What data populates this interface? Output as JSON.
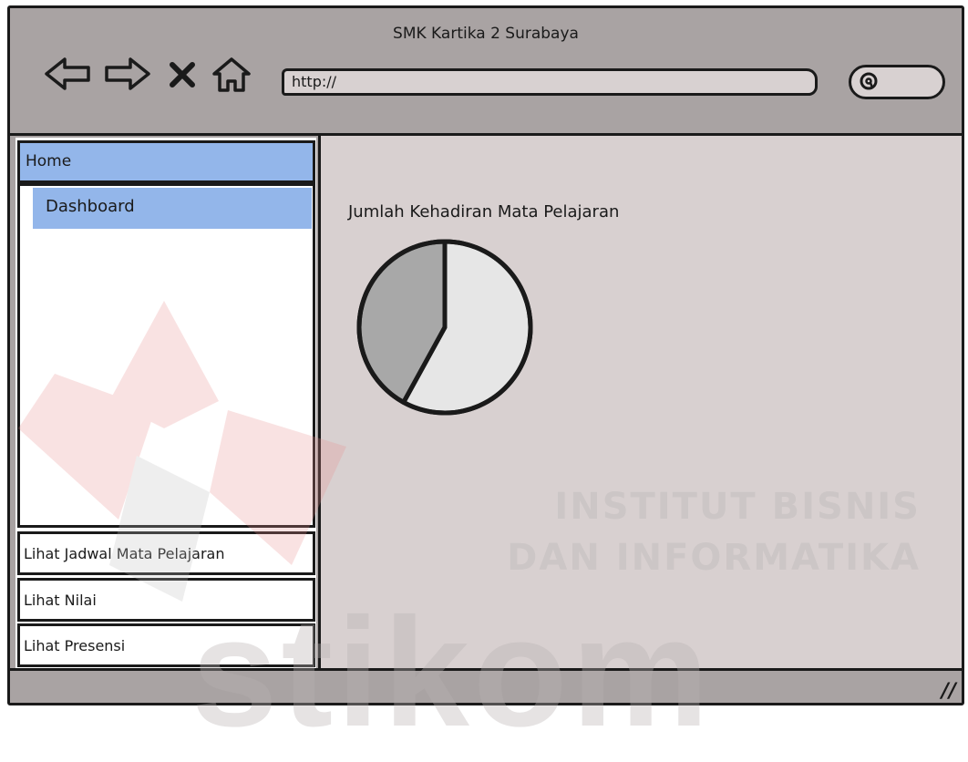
{
  "window": {
    "title": "SMK Kartika 2 Surabaya",
    "url": "http://"
  },
  "toolbar": {
    "back_icon": "arrow-left-icon",
    "forward_icon": "arrow-right-icon",
    "stop_icon": "close-icon",
    "home_icon": "home-icon",
    "search_icon": "search-icon"
  },
  "sidebar": {
    "home_label": "Home",
    "dashboard_label": "Dashboard",
    "items": [
      {
        "label": "Lihat Jadwal Mata Pelajaran"
      },
      {
        "label": "Lihat Nilai"
      },
      {
        "label": "Lihat Presensi"
      }
    ]
  },
  "main": {
    "chart_title": "Jumlah Kehadiran Mata Pelajaran"
  },
  "chart_data": {
    "type": "pie",
    "title": "Jumlah Kehadiran Mata Pelajaran",
    "values": [
      58,
      42
    ],
    "colors": [
      "#e6e6e6",
      "#a8a8a8"
    ]
  },
  "watermark": {
    "line1": "INSTITUT BISNIS",
    "line2": "DAN INFORMATIKA",
    "brand": "stikom"
  },
  "colors": {
    "chrome": "#a9a3a3",
    "content_bg": "#d8d0d0",
    "highlight": "#93b6ea"
  }
}
